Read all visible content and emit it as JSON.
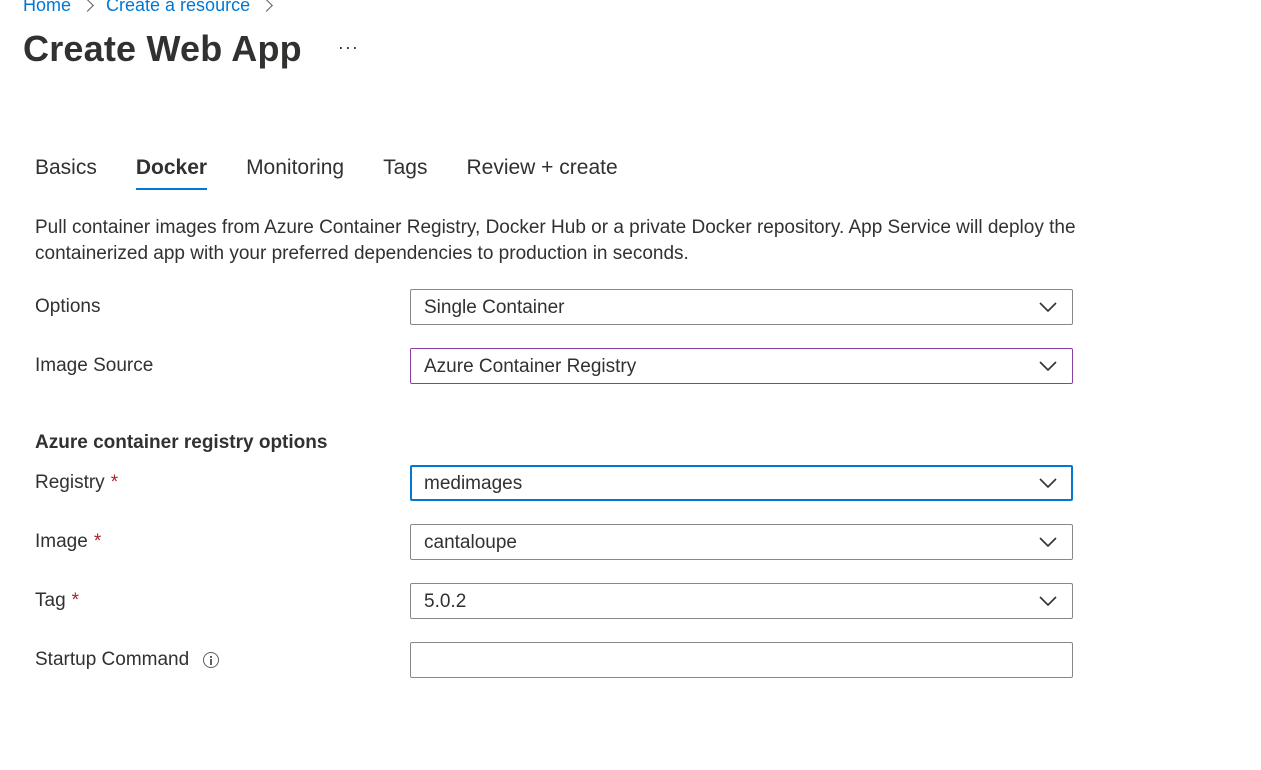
{
  "breadcrumb": {
    "items": [
      "Home",
      "Create a resource"
    ]
  },
  "header": {
    "title": "Create Web App",
    "more_label": "···"
  },
  "tabs": [
    {
      "label": "Basics",
      "active": false
    },
    {
      "label": "Docker",
      "active": true
    },
    {
      "label": "Monitoring",
      "active": false
    },
    {
      "label": "Tags",
      "active": false
    },
    {
      "label": "Review + create",
      "active": false
    }
  ],
  "description": "Pull container images from Azure Container Registry, Docker Hub or a private Docker repository. App Service will deploy the containerized app with your preferred dependencies to production in seconds.",
  "form": {
    "options": {
      "label": "Options",
      "value": "Single Container"
    },
    "image_source": {
      "label": "Image Source",
      "value": "Azure Container Registry"
    },
    "section_heading": "Azure container registry options",
    "registry": {
      "label": "Registry",
      "required": "*",
      "value": "medimages"
    },
    "image": {
      "label": "Image",
      "required": "*",
      "value": "cantaloupe"
    },
    "tag": {
      "label": "Tag",
      "required": "*",
      "value": "5.0.2"
    },
    "startup_command": {
      "label": "Startup Command",
      "value": "",
      "placeholder": ""
    }
  },
  "colors": {
    "link": "#0078d4",
    "text": "#323130",
    "required": "#a4262c",
    "focus_border": "#0078d4",
    "hover_border": "#8a3f9e",
    "border": "#8a8886"
  },
  "icons": {
    "chevron": "chevron-down-icon",
    "info": "info-icon",
    "breadcrumb_separator": "chevron-right-icon"
  }
}
